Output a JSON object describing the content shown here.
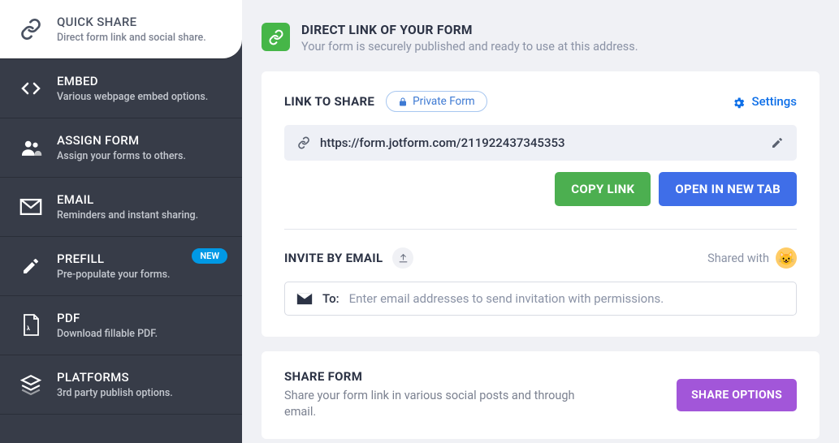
{
  "sidebar": [
    {
      "title": "QUICK SHARE",
      "subtitle": "Direct form link and social share."
    },
    {
      "title": "EMBED",
      "subtitle": "Various webpage embed options."
    },
    {
      "title": "ASSIGN FORM",
      "subtitle": "Assign your forms to others."
    },
    {
      "title": "EMAIL",
      "subtitle": "Reminders and instant sharing."
    },
    {
      "title": "PREFILL",
      "subtitle": "Pre-populate your forms.",
      "badge": "NEW"
    },
    {
      "title": "PDF",
      "subtitle": "Download fillable PDF."
    },
    {
      "title": "PLATFORMS",
      "subtitle": "3rd party publish options."
    }
  ],
  "hero": {
    "title": "DIRECT LINK OF YOUR FORM",
    "subtitle": "Your form is securely published and ready to use at this address."
  },
  "link_section": {
    "title": "LINK TO SHARE",
    "private_label": "Private Form",
    "settings_label": "Settings",
    "url": "https://form.jotform.com/211922437345353",
    "copy_btn": "COPY LINK",
    "open_btn": "OPEN IN NEW TAB"
  },
  "invite_section": {
    "title": "INVITE BY EMAIL",
    "shared_with": "Shared with",
    "to_label": "To:",
    "placeholder": "Enter email addresses to send invitation with permissions."
  },
  "share_form": {
    "title": "SHARE FORM",
    "subtitle": "Share your form link in various social posts and through email.",
    "button": "SHARE OPTIONS"
  }
}
